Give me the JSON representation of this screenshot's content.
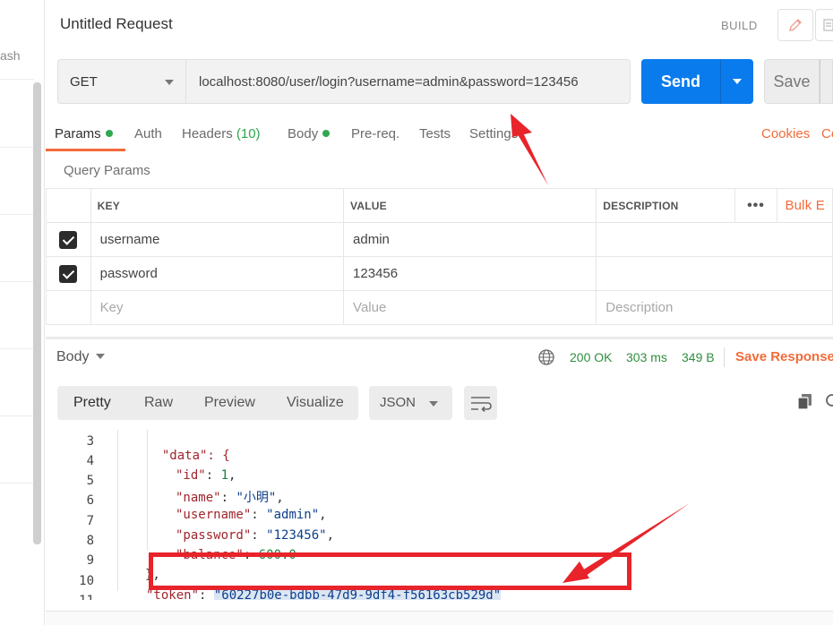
{
  "sidebar": {
    "partial_label": "ash"
  },
  "request": {
    "title": "Untitled Request",
    "build_label": "BUILD",
    "method": "GET",
    "url": "localhost:8080/user/login?username=admin&password=123456",
    "send_label": "Send",
    "save_label": "Save"
  },
  "tabs": [
    {
      "label": "Params",
      "dot": true
    },
    {
      "label": "Auth"
    },
    {
      "label": "Headers",
      "count": "(10)"
    },
    {
      "label": "Body",
      "dot": true
    },
    {
      "label": "Pre-req."
    },
    {
      "label": "Tests"
    },
    {
      "label": "Settings"
    }
  ],
  "links": {
    "cookies": "Cookies",
    "code": "Co"
  },
  "query_params": {
    "label": "Query Params",
    "headers": {
      "key": "KEY",
      "value": "VALUE",
      "description": "DESCRIPTION",
      "more": "•••",
      "bulk_edit": "Bulk E"
    },
    "rows": [
      {
        "checked": true,
        "key": "username",
        "value": "admin",
        "description": ""
      },
      {
        "checked": true,
        "key": "password",
        "value": "123456",
        "description": ""
      }
    ],
    "placeholder": {
      "key": "Key",
      "value": "Value",
      "description": "Description"
    }
  },
  "response": {
    "body_label": "Body",
    "status": "200 OK",
    "time": "303 ms",
    "size": "349 B",
    "save_response": "Save Response",
    "view_tabs": [
      "Pretty",
      "Raw",
      "Preview",
      "Visualize"
    ],
    "format": "JSON"
  },
  "code": {
    "lines": [
      {
        "no": "3",
        "text": "  \"data\": {"
      },
      {
        "no": "4",
        "key": "\"id\"",
        "value": "1",
        "type": "num",
        "trail": ","
      },
      {
        "no": "5",
        "key": "\"name\"",
        "value": "\"小明\"",
        "type": "str",
        "trail": ","
      },
      {
        "no": "6",
        "key": "\"username\"",
        "value": "\"admin\"",
        "type": "str",
        "trail": ","
      },
      {
        "no": "7",
        "key": "\"password\"",
        "value": "\"123456\"",
        "type": "str",
        "trail": ","
      },
      {
        "no": "8",
        "key": "\"balance\"",
        "value": "600.0",
        "type": "num",
        "trail": ""
      },
      {
        "no": "9",
        "text": "},"
      },
      {
        "no": "10",
        "key": "\"token\"",
        "value": "\"60227b0e-bdbb-47d9-9df4-f56163cb529d\"",
        "type": "str",
        "trail": ""
      },
      {
        "no": "11",
        "text": "}"
      }
    ]
  },
  "colors": {
    "accent": "#f26b3a",
    "send": "#097bed",
    "annotation": "#e8232a",
    "status_ok": "#2f8f3f"
  }
}
